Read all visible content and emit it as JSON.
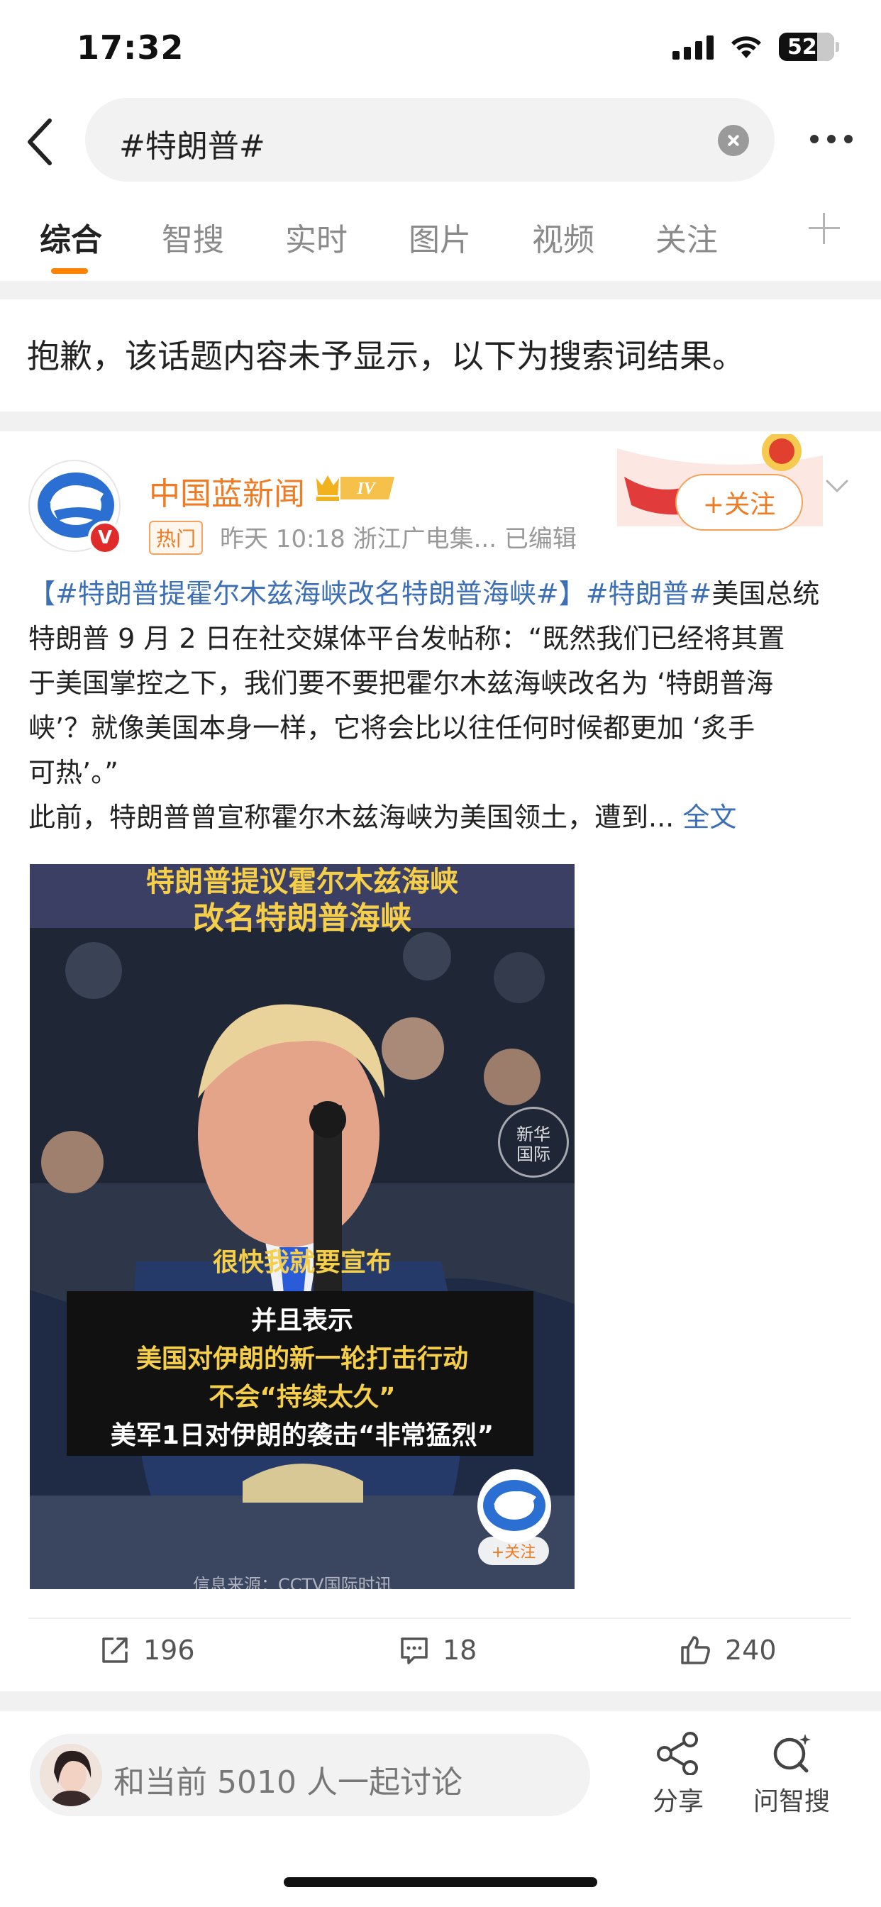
{
  "status_bar": {
    "time": "17:32",
    "battery": "52"
  },
  "search": {
    "query": "#特朗普#"
  },
  "tabs": [
    {
      "label": "综合"
    },
    {
      "label": "智搜"
    },
    {
      "label": "实时"
    },
    {
      "label": "图片"
    },
    {
      "label": "视频"
    },
    {
      "label": "关注"
    }
  ],
  "notice": "抱歉，该话题内容未予显示，以下为搜索词结果。",
  "post": {
    "author": "中国蓝新闻",
    "level": "IV",
    "hot_badge": "热门",
    "meta": "昨天 10:18  浙江广电集...  已编辑",
    "follow_label": "+关注",
    "tag1": "【#特朗普提霍尔木兹海峡改名特朗普海峡#】",
    "tag2": "#特朗普#",
    "line1_tail": "美国总统",
    "line2": "特朗普 9 月 2 日在社交媒体平台发帖称：“既然我们已经将其置",
    "line3": "于美国掌控之下，我们要不要把霍尔木兹海峡改名为 ‘特朗普海",
    "line4": "峡’？就像美国本身一样，它将会比以往任何时候都更加 ‘炙手",
    "line5": "可热’。”",
    "line6": "此前，特朗普曾宣称霍尔木兹海峡为美国领土，遭到...",
    "full_text": "全文",
    "video": {
      "title_line1": "特朗普提议霍尔木兹海峡",
      "title_line2": "改名特朗普海峡",
      "caption1": "很快我就要宣布",
      "caption2": "并且表示",
      "caption3": "美国对伊朗的新一轮打击行动",
      "caption4": "不会“持续太久”",
      "caption5": "美军1日对伊朗的袭击“非常猛烈”",
      "watermark": "新华\n国际",
      "follow": "+关注",
      "source": "信息来源：CCTV国际时讯"
    },
    "reposts": "196",
    "comments": "18",
    "likes": "240"
  },
  "bottom": {
    "discuss": "和当前 5010 人一起讨论",
    "share": "分享",
    "ask_ai": "问智搜"
  },
  "colors": {
    "accent": "#ff8200",
    "link": "#3c6fb4",
    "author": "#f07b22"
  }
}
